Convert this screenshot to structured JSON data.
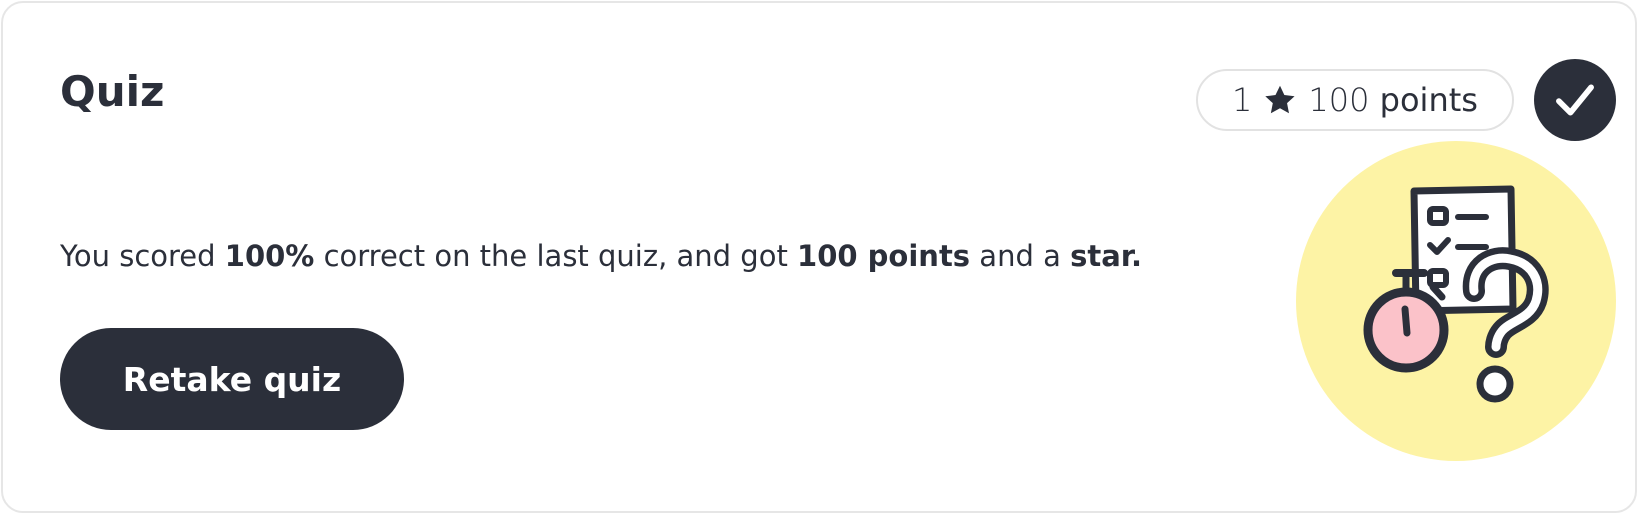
{
  "quiz": {
    "title": "Quiz",
    "stars_count": "1",
    "points_number": "100",
    "points_word": "points",
    "message": {
      "part1": "You scored ",
      "score": "100%",
      "part2": " correct on the last quiz, and got ",
      "points": "100 points",
      "part3": " and a ",
      "star": "star."
    },
    "retake_label": "Retake quiz",
    "status": "completed"
  },
  "icons": {
    "star": "star-icon",
    "check": "check-icon",
    "illustration": "quiz-illustration-icon"
  },
  "colors": {
    "dark": "#2b2f3a",
    "border": "#e6e6e6",
    "illustration_bg": "#fdf3a5",
    "stopwatch_face": "#fbc2c9"
  }
}
